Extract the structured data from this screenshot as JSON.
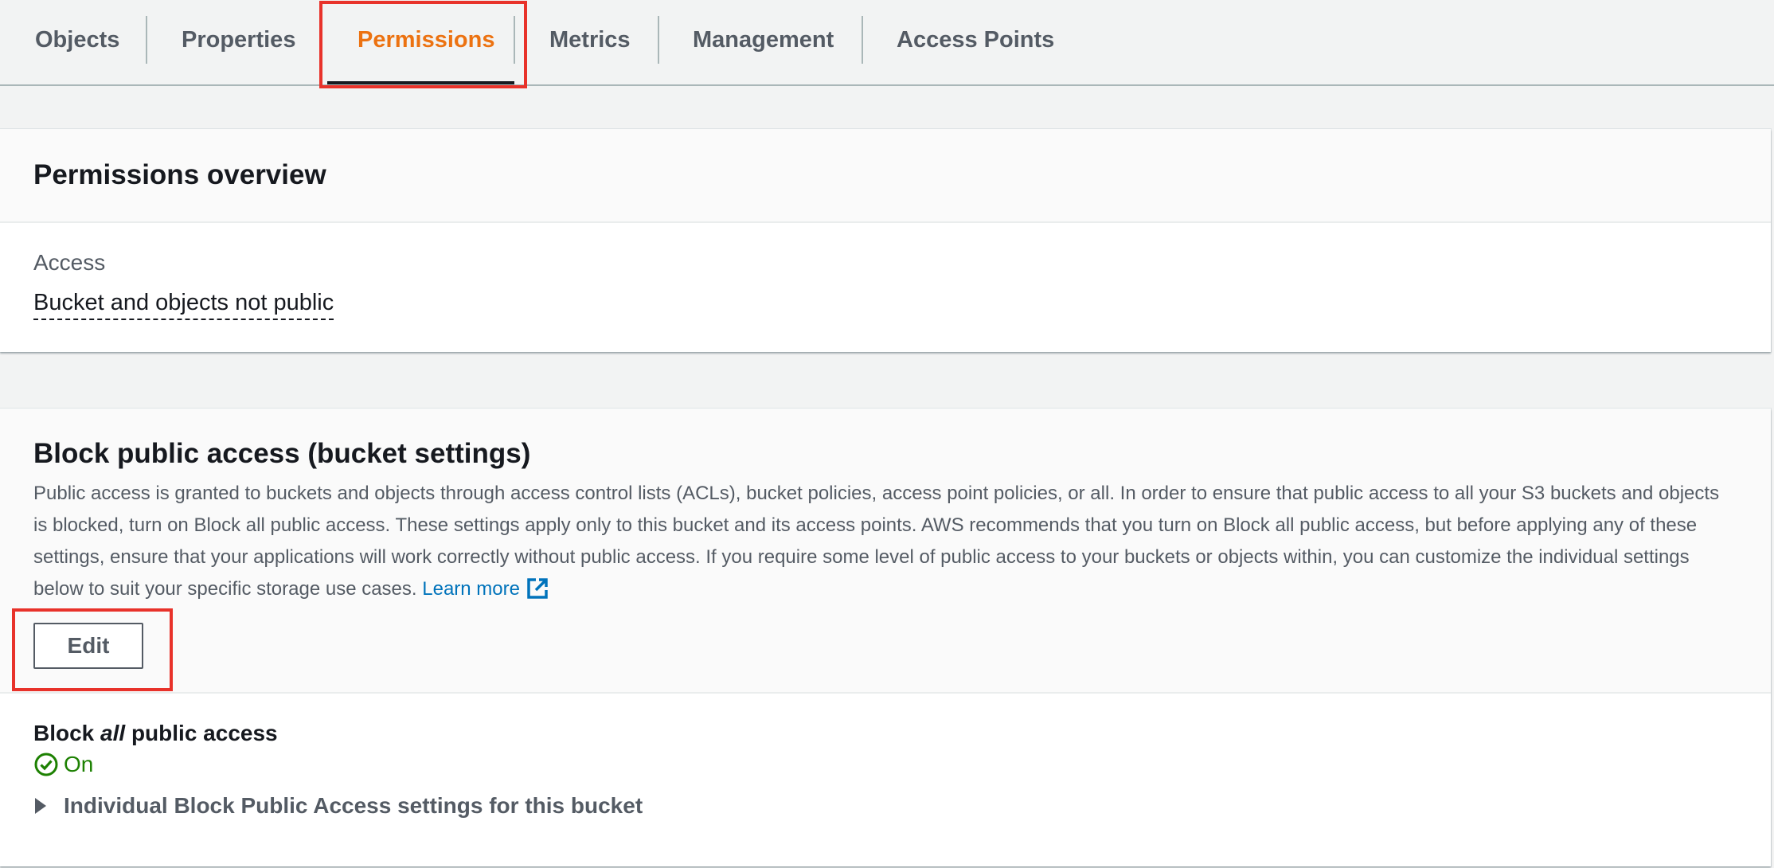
{
  "tabs": [
    {
      "label": "Objects",
      "active": false
    },
    {
      "label": "Properties",
      "active": false
    },
    {
      "label": "Permissions",
      "active": true
    },
    {
      "label": "Metrics",
      "active": false
    },
    {
      "label": "Management",
      "active": false
    },
    {
      "label": "Access Points",
      "active": false
    }
  ],
  "overview": {
    "title": "Permissions overview",
    "access_label": "Access",
    "access_value": "Bucket and objects not public"
  },
  "block_public_access": {
    "title": "Block public access (bucket settings)",
    "description": "Public access is granted to buckets and objects through access control lists (ACLs), bucket policies, access point policies, or all. In order to ensure that public access to all your S3 buckets and objects is blocked, turn on Block all public access. These settings apply only to this bucket and its access points. AWS recommends that you turn on Block all public access, but before applying any of these settings, ensure that your applications will work correctly without public access. If you require some level of public access to your buckets or objects within, you can customize the individual settings below to suit your specific storage use cases.",
    "learn_more": "Learn more",
    "edit_label": "Edit",
    "setting_prefix": "Block ",
    "setting_emphasis": "all",
    "setting_suffix": " public access",
    "status": "On",
    "expander_label": "Individual Block Public Access settings for this bucket"
  },
  "colors": {
    "accent": "#ec7211",
    "link": "#0073bb",
    "success": "#1d8102",
    "highlight": "#e8322a"
  },
  "icons": [
    "external-link-icon",
    "check-circle-icon",
    "caret-right-icon"
  ]
}
